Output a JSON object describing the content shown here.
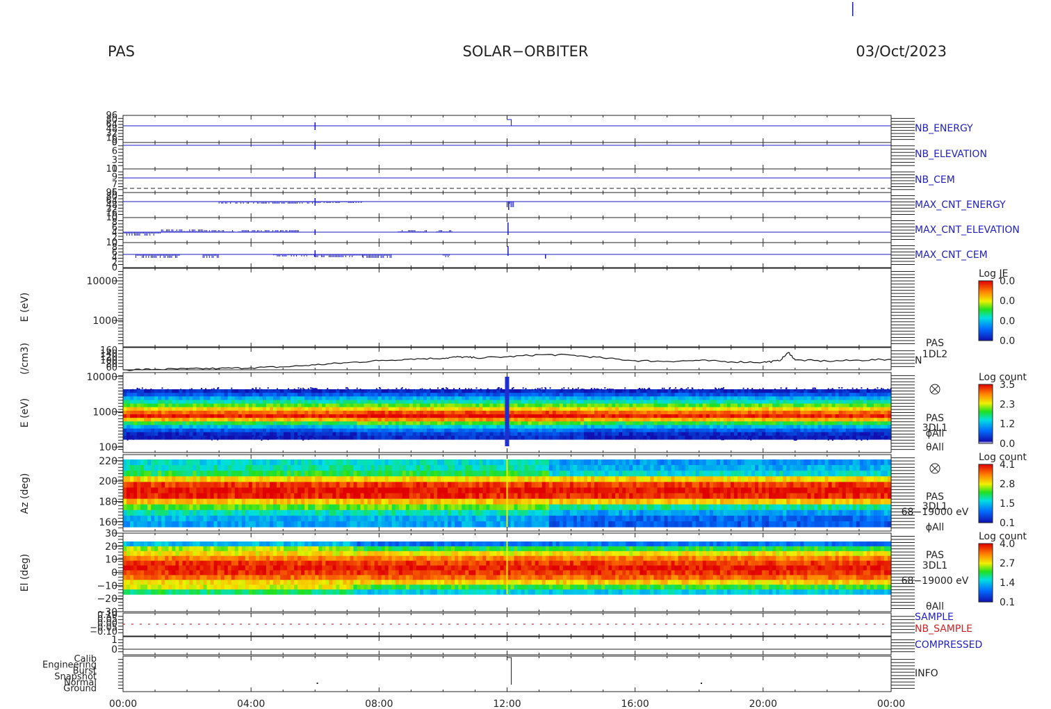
{
  "header": {
    "left": "PAS",
    "center": "SOLAR−ORBITER",
    "right": "03/Oct/2023"
  },
  "chart_data": {
    "type": "multi-panel time series and spectrogram",
    "x_ticks": [
      "00:00",
      "04:00",
      "08:00",
      "12:00",
      "16:00",
      "20:00",
      "00:00"
    ],
    "x_range_hours": [
      0,
      24
    ],
    "panels": [
      {
        "id": "nb_energy",
        "type": "line",
        "label": "NB_ENERGY",
        "label_color": "#2020c0",
        "yticks": [
          "96",
          "80",
          "64",
          "48",
          "32",
          "16",
          "0"
        ]
      },
      {
        "id": "nb_elevation",
        "type": "line",
        "label": "NB_ELEVATION",
        "label_color": "#2020c0",
        "yticks": [
          "9",
          "6",
          "3",
          "0"
        ]
      },
      {
        "id": "nb_cem",
        "type": "line",
        "label": "NB_CEM",
        "label_color": "#2020c0",
        "yticks": [
          "11",
          "9",
          "7",
          "5"
        ]
      },
      {
        "id": "max_cnt_energy",
        "type": "line",
        "label": "MAX_CNT_ENERGY",
        "label_color": "#2020c0",
        "yticks": [
          "96",
          "80",
          "64",
          "48",
          "32",
          "16",
          "0"
        ]
      },
      {
        "id": "max_cnt_elevation",
        "type": "line",
        "label": "MAX_CNT_ELEVATION",
        "label_color": "#2020c0",
        "yticks": [
          "10",
          "8",
          "6",
          "4",
          "2",
          "0"
        ]
      },
      {
        "id": "max_cnt_cem",
        "type": "line",
        "label": "MAX_CNT_CEM",
        "label_color": "#2020c0",
        "yticks": [
          "10",
          "8",
          "6",
          "4",
          "2",
          "0"
        ]
      },
      {
        "id": "je",
        "type": "spectrogram-empty",
        "ylabel": "E (eV)",
        "yticks": [
          "10000",
          "1000"
        ],
        "ylog": true,
        "yrange": [
          40,
          20000
        ],
        "colorbar": {
          "title": "Log JE",
          "ticks": [
            "0.0",
            "0.0",
            "0.0",
            "0.0"
          ]
        }
      },
      {
        "id": "density",
        "type": "line",
        "ylabel": "(/cm3)",
        "yticks": [
          "160",
          "140",
          "120",
          "100",
          "80",
          "60"
        ],
        "yrange": [
          60,
          160
        ],
        "side_label": [
          "PAS",
          "1DL2"
        ],
        "series_name": "N",
        "x_hours": [
          0,
          1,
          2,
          3,
          4,
          5,
          6,
          7,
          8,
          9,
          10,
          10.5,
          11,
          12,
          13,
          14,
          15,
          16,
          17,
          18,
          19,
          20,
          20.5,
          20.8,
          21,
          22,
          23,
          24
        ],
        "values": [
          60,
          62,
          64,
          66,
          69,
          73,
          82,
          92,
          101,
          109,
          112,
          118,
          114,
          118,
          128,
          126,
          113,
          101,
          98,
          102,
          96,
          94,
          100,
          138,
          104,
          99,
          103,
          107
        ]
      },
      {
        "id": "energy_spec",
        "type": "heatmap",
        "ylabel": "E (eV)",
        "yticks": [
          "10000",
          "1000",
          "100"
        ],
        "ylog": true,
        "yrange": [
          70,
          13000
        ],
        "side_label": [
          "PAS",
          "3DL1",
          "ϕAll",
          "θAll"
        ],
        "colorbar": {
          "title": "Log count",
          "ticks": [
            "3.5",
            "2.3",
            "1.2",
            "0.0"
          ]
        }
      },
      {
        "id": "azimuth",
        "type": "heatmap",
        "ylabel": "Az (deg)",
        "yticks": [
          "220",
          "200",
          "180",
          "160"
        ],
        "yrange": [
          151,
          226
        ],
        "side_label": [
          "PAS",
          "3DL1",
          "68−19000 eV",
          "ϕAll"
        ],
        "colorbar": {
          "title": "Log count",
          "ticks": [
            "4.1",
            "2.8",
            "1.5",
            "0.1"
          ]
        }
      },
      {
        "id": "elevation",
        "type": "heatmap",
        "ylabel": "El (deg)",
        "yticks": [
          "30",
          "20",
          "10",
          "0",
          "−10",
          "−20",
          "−30"
        ],
        "yrange": [
          -30,
          30
        ],
        "side_label": [
          "PAS",
          "3DL1",
          "68−19000 eV",
          "θAll"
        ],
        "colorbar": {
          "title": "Log count",
          "ticks": [
            "4.0",
            "2.7",
            "1.4",
            "0.1"
          ]
        }
      },
      {
        "id": "sample",
        "type": "line",
        "yticks": [
          "0.10",
          "0.05",
          "0.00",
          "−0.05",
          "−0.10"
        ],
        "labels": [
          {
            "text": "SAMPLE",
            "color": "#2020c0"
          },
          {
            "text": "NB_SAMPLE",
            "color": "#d02020"
          }
        ]
      },
      {
        "id": "compressed",
        "type": "line",
        "yticks": [
          "1",
          "0"
        ],
        "labels": [
          {
            "text": "COMPRESSED",
            "color": "#2020c0"
          }
        ]
      },
      {
        "id": "info",
        "type": "line",
        "yticks": [
          "Calib",
          "Engineering",
          "Burst",
          "Snapshot",
          "Normal",
          "Ground"
        ],
        "labels": [
          {
            "text": "INFO",
            "color": "#222222"
          }
        ]
      }
    ]
  }
}
